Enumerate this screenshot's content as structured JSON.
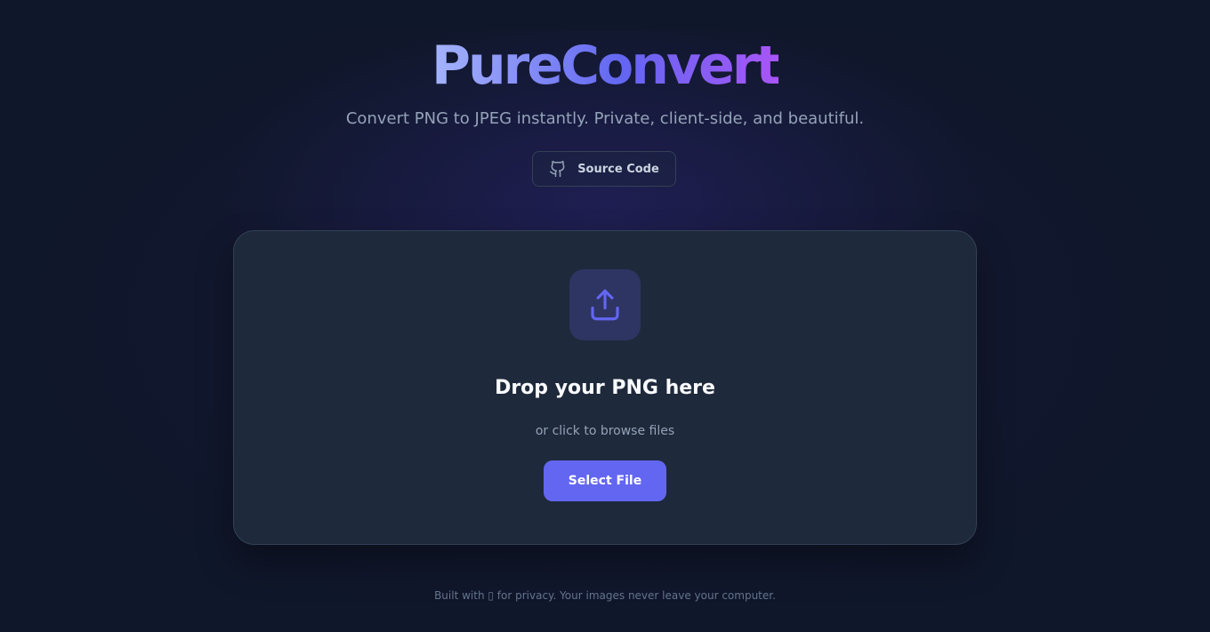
{
  "header": {
    "title": "PureConvert",
    "subtitle": "Convert PNG to JPEG instantly. Private, client-side, and beautiful.",
    "source_button": {
      "label": "Source Code",
      "icon": "github-icon"
    }
  },
  "dropzone": {
    "icon": "upload-icon",
    "title": "Drop your PNG here",
    "subtitle": "or click to browse files",
    "button_label": "Select File"
  },
  "footer": {
    "text": "Built with ▯ for privacy. Your images never leave your computer."
  },
  "colors": {
    "accent": "#6366f1",
    "background": "#0f172a",
    "card": "#1e293b",
    "border": "#334155",
    "muted_text": "#94a3b8"
  }
}
